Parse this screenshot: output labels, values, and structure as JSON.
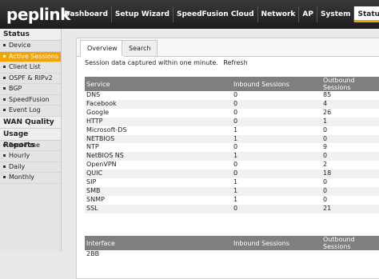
{
  "brand": {
    "logo_text": "peplink"
  },
  "nav": {
    "items": [
      "Dashboard",
      "Setup Wizard",
      "SpeedFusion Cloud",
      "Network",
      "AP",
      "System",
      "Status"
    ],
    "active": "Status"
  },
  "sidebar": {
    "sections": [
      {
        "title": "Status",
        "items": [
          "Device",
          "Active Sessions",
          "Client List",
          "OSPF & RIPv2",
          "BGP",
          "SpeedFusion",
          "Event Log"
        ]
      },
      {
        "title": "WAN Quality",
        "items": []
      },
      {
        "title": "Usage Reports",
        "items": [
          "Real-Time",
          "Hourly",
          "Daily",
          "Monthly"
        ]
      }
    ],
    "active_item": "Active Sessions"
  },
  "tabs": {
    "overview": "Overview",
    "search": "Search"
  },
  "note": {
    "text": "Session data captured within one minute.",
    "refresh": "Refresh"
  },
  "service_table": {
    "headers": [
      "Service",
      "Inbound Sessions",
      "Outbound Sessions"
    ],
    "rows": [
      [
        "DNS",
        "0",
        "85"
      ],
      [
        "Facebook",
        "0",
        "4"
      ],
      [
        "Google",
        "0",
        "26"
      ],
      [
        "HTTP",
        "0",
        "1"
      ],
      [
        "Microsoft-DS",
        "1",
        "0"
      ],
      [
        "NETBIOS",
        "1",
        "0"
      ],
      [
        "NTP",
        "0",
        "9"
      ],
      [
        "NetBIOS NS",
        "1",
        "0"
      ],
      [
        "OpenVPN",
        "0",
        "2"
      ],
      [
        "QUIC",
        "0",
        "18"
      ],
      [
        "SIP",
        "1",
        "0"
      ],
      [
        "SMB",
        "1",
        "0"
      ],
      [
        "SNMP",
        "1",
        "0"
      ],
      [
        "SSL",
        "0",
        "21"
      ]
    ]
  },
  "interface_table": {
    "headers": [
      "Interface",
      "Inbound Sessions",
      "Outbound Sessions"
    ],
    "rows": [
      [
        "2BB",
        "",
        ""
      ]
    ]
  },
  "colors": {
    "accent": "#f5a300",
    "header_bg": "#7f7f7f",
    "topbar": "#2a2a2a"
  }
}
